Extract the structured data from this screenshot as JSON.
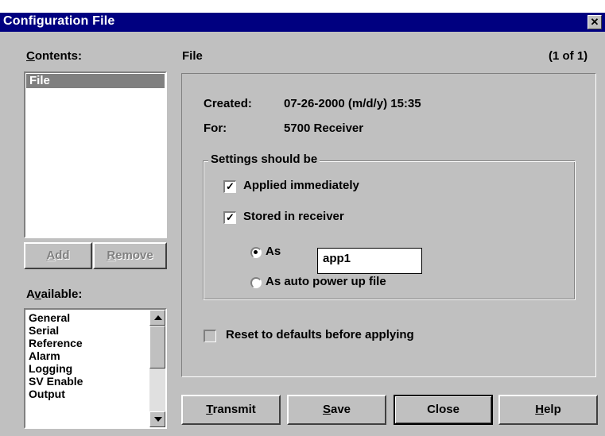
{
  "window": {
    "title": "Configuration File",
    "close_icon": "close-icon"
  },
  "contents": {
    "label": "Contents:",
    "items": [
      "File"
    ]
  },
  "buttons": {
    "add": "Add",
    "remove": "Remove"
  },
  "available": {
    "label": "Available:",
    "items": [
      "General",
      "Serial",
      "Reference",
      "Alarm",
      "Logging",
      "SV Enable",
      "Output"
    ]
  },
  "panel": {
    "title": "File",
    "page": "(1 of 1)",
    "created_label": "Created:",
    "created_value": "07-26-2000 (m/d/y) 15:35",
    "for_label": "For:",
    "for_value": "5700 Receiver"
  },
  "settings": {
    "legend": "Settings should be",
    "applied": {
      "label": "Applied immediately",
      "checked": true
    },
    "stored": {
      "label": "Stored in receiver",
      "checked": true
    },
    "as": {
      "label": "As",
      "selected": true,
      "value": "app1"
    },
    "auto": {
      "label": "As auto power up file",
      "selected": false
    }
  },
  "reset": {
    "label": "Reset to defaults before applying",
    "checked": false
  },
  "footer": {
    "transmit": "Transmit",
    "save": "Save",
    "close": "Close",
    "help": "Help"
  },
  "colors": {
    "titlebar": "#000080",
    "face": "#c0c0c0",
    "selection": "#808080"
  }
}
